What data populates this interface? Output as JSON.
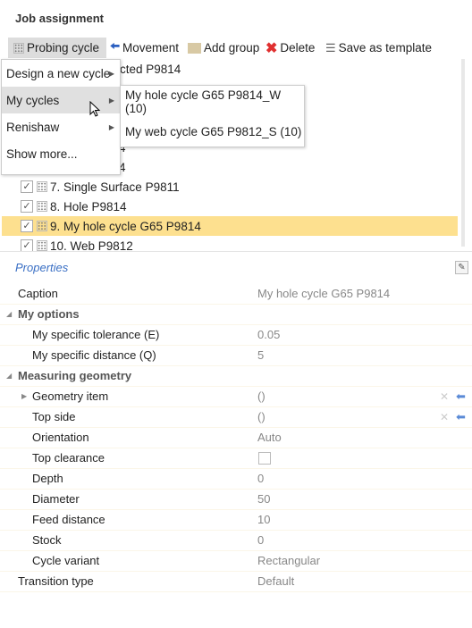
{
  "title": "Job assignment",
  "toolbar": {
    "probing_cycle": "Probing cycle",
    "movement": "Movement",
    "add_group": "Add group",
    "delete": "Delete",
    "save_template": "Save as template"
  },
  "tree": {
    "rows": [
      {
        "label": "cted P9814",
        "checked": true,
        "partial": true
      },
      {
        "label": "",
        "checked": true,
        "partial": true
      },
      {
        "label": "",
        "checked": true,
        "partial": true
      },
      {
        "label": "",
        "checked": true,
        "partial": true
      },
      {
        "label": "4",
        "checked": true,
        "partial": true
      },
      {
        "label": "4",
        "checked": true,
        "partial": true
      },
      {
        "label": "7. Single Surface P9811",
        "checked": true
      },
      {
        "label": "8. Hole P9814",
        "checked": true
      },
      {
        "label": "9. My hole cycle G65 P9814",
        "checked": true,
        "selected": true
      },
      {
        "label": "10. Web P9812",
        "checked": true
      }
    ]
  },
  "menu": {
    "items": [
      {
        "label": "Design a new cycle",
        "submenu": true
      },
      {
        "label": "My cycles",
        "submenu": true,
        "highlighted": true
      },
      {
        "label": "Renishaw",
        "submenu": true
      },
      {
        "label": "Show more...",
        "submenu": false
      }
    ]
  },
  "submenu": {
    "items": [
      "My hole cycle G65 P9814_W (10)",
      "My web cycle G65 P9812_S (10)"
    ]
  },
  "properties": {
    "header": "Properties",
    "rows": [
      {
        "label": "Caption",
        "value": "My hole cycle G65 P9814",
        "level": 0
      },
      {
        "label": "My options",
        "group": true,
        "level": 0
      },
      {
        "label": "My specific tolerance (E)",
        "value": "0.05",
        "level": 1
      },
      {
        "label": "My specific distance (Q)",
        "value": "5",
        "level": 1
      },
      {
        "label": "Measuring geometry",
        "group": true,
        "level": 0
      },
      {
        "label": "Geometry item",
        "value": "()",
        "level": 1,
        "expandable": true,
        "pick": true
      },
      {
        "label": "Top side",
        "value": "()",
        "level": 1,
        "pick": true
      },
      {
        "label": "Orientation",
        "value": "Auto",
        "level": 1
      },
      {
        "label": "Top clearance",
        "checkbox": false,
        "level": 1
      },
      {
        "label": "Depth",
        "value": "0",
        "level": 1
      },
      {
        "label": "Diameter",
        "value": "50",
        "level": 1
      },
      {
        "label": "Feed distance",
        "value": "10",
        "level": 1
      },
      {
        "label": "Stock",
        "value": "0",
        "level": 1
      },
      {
        "label": "Cycle variant",
        "value": "Rectangular",
        "level": 1
      },
      {
        "label": "Transition type",
        "value": "Default",
        "level": 0
      }
    ]
  },
  "colors": {
    "selected_row": "#fde08f",
    "accent": "#3a6fc4"
  }
}
